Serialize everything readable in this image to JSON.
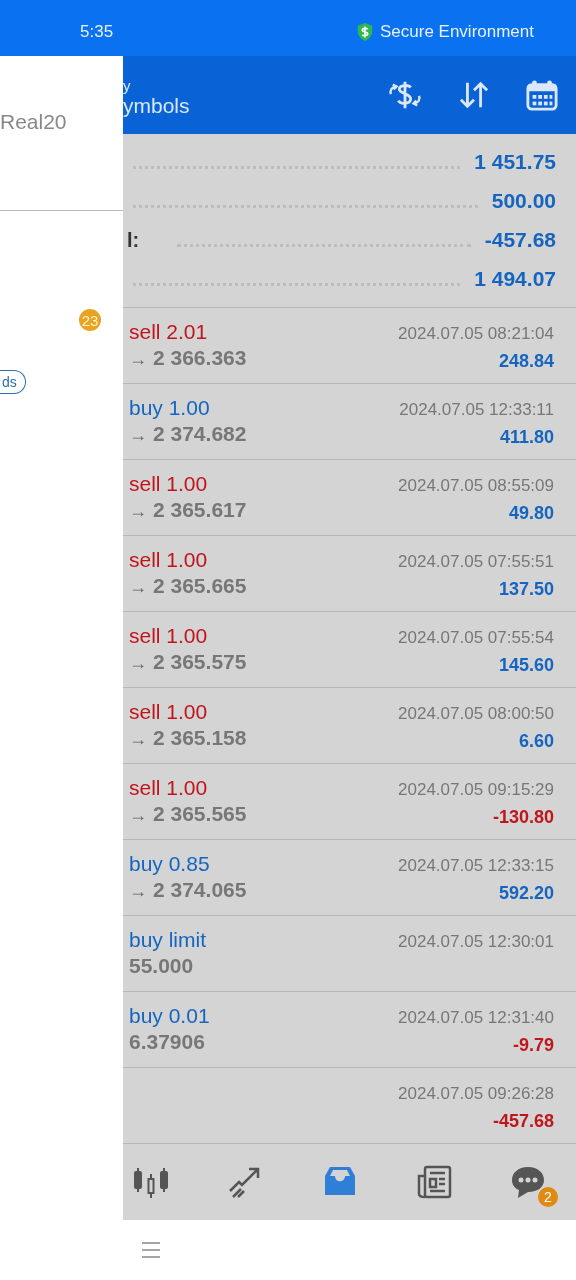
{
  "status_bar": {
    "time": "5:35",
    "secure_label": "Secure Environment"
  },
  "drawer": {
    "account": "Real20",
    "badge": "23",
    "chip": "ds"
  },
  "header": {
    "subtitle": "y",
    "title": "ymbols"
  },
  "summary": [
    {
      "value": "1 451.75"
    },
    {
      "value": "500.00"
    },
    {
      "label": "l:",
      "value": "-457.68"
    },
    {
      "value": "1 494.07"
    }
  ],
  "trades": [
    {
      "kind": "sell",
      "type": "sell 2.01",
      "arrow": "→",
      "price": "2 366.363",
      "time": "2024.07.05 08:21:04",
      "profit": "248.84",
      "loss": false
    },
    {
      "kind": "buy",
      "type": "buy 1.00",
      "arrow": "→",
      "price": "2 374.682",
      "time": "2024.07.05 12:33:11",
      "profit": "411.80",
      "loss": false
    },
    {
      "kind": "sell",
      "type": "sell 1.00",
      "arrow": "→",
      "price": "2 365.617",
      "time": "2024.07.05 08:55:09",
      "profit": "49.80",
      "loss": false
    },
    {
      "kind": "sell",
      "type": "sell 1.00",
      "arrow": "→",
      "price": "2 365.665",
      "time": "2024.07.05 07:55:51",
      "profit": "137.50",
      "loss": false
    },
    {
      "kind": "sell",
      "type": "sell 1.00",
      "arrow": "→",
      "price": "2 365.575",
      "time": "2024.07.05 07:55:54",
      "profit": "145.60",
      "loss": false
    },
    {
      "kind": "sell",
      "type": "sell 1.00",
      "arrow": "→",
      "price": "2 365.158",
      "time": "2024.07.05 08:00:50",
      "profit": "6.60",
      "loss": false
    },
    {
      "kind": "sell",
      "type": "sell 1.00",
      "arrow": "→",
      "price": "2 365.565",
      "time": "2024.07.05 09:15:29",
      "profit": "-130.80",
      "loss": true
    },
    {
      "kind": "buy",
      "type": "buy 0.85",
      "arrow": "→",
      "price": "2 374.065",
      "time": "2024.07.05 12:33:15",
      "profit": "592.20",
      "loss": false
    },
    {
      "kind": "buy",
      "type": "buy limit",
      "price": "55.000",
      "time": "2024.07.05 12:30:01"
    },
    {
      "kind": "buy",
      "type": "buy 0.01",
      "price": "6.37906",
      "time": "2024.07.05 12:31:40",
      "profit": "-9.79",
      "loss": true
    },
    {
      "time": "2024.07.05 09:26:28",
      "profit": "-457.68",
      "loss": true
    }
  ],
  "bottom_nav": [
    {
      "kind": "quotes",
      "selected": false
    },
    {
      "kind": "chart",
      "selected": false
    },
    {
      "kind": "trade",
      "selected": true
    },
    {
      "kind": "news",
      "selected": false
    },
    {
      "kind": "chat",
      "selected": false,
      "badge": "2"
    }
  ]
}
